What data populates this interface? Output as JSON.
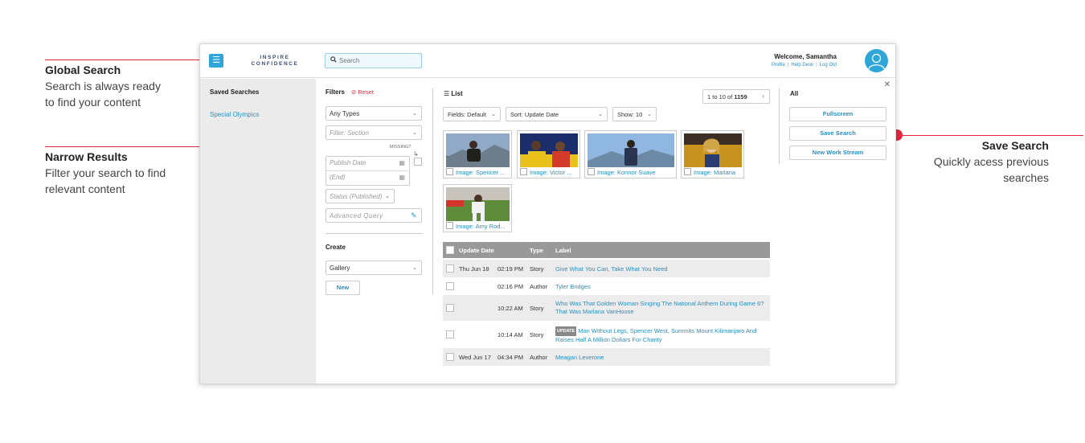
{
  "annotations": {
    "global_search": {
      "title": "Global Search",
      "line1": "Search is always ready",
      "line2": "to find your content"
    },
    "narrow_results": {
      "title": "Narrow Results",
      "line1": "Filter your search to find",
      "line2": "relevant content"
    },
    "save_search": {
      "title": "Save Search",
      "line1": "Quickly acess previous",
      "line2": "searches"
    }
  },
  "colors": {
    "accent": "#e8253d",
    "brand_blue": "#2fa6d8",
    "link": "#2a8fc1"
  },
  "header": {
    "brand_line1": "INSPIRE",
    "brand_line2": "CONFIDENCE",
    "search_placeholder": "Search",
    "welcome": "Welcome, Samantha",
    "links": [
      "Profile",
      "Help Desk",
      "Log Out"
    ]
  },
  "sidebar": {
    "title": "Saved Searches",
    "items": [
      "Special Olympics"
    ]
  },
  "filters": {
    "title": "Filters",
    "reset": "Reset",
    "types": "Any Types",
    "section_placeholder": "Filter: Section",
    "missing": "MISSING?",
    "publish_date": "Publish Date",
    "end": "(End)",
    "status": "Status (Published)",
    "advanced_query": "Advanced Query"
  },
  "create": {
    "title": "Create",
    "select": "Gallery",
    "new": "New"
  },
  "list": {
    "title": "List",
    "pager_prefix": "1 to 10 of",
    "pager_total": "1159",
    "fields": "Fields: Default",
    "sort": "Sort: Update Date",
    "show": "Show: 10",
    "thumbnails": [
      {
        "label": "Image: Spencer ..."
      },
      {
        "label": "Image: Victor ..."
      },
      {
        "label": "Image: Konnor Suave"
      },
      {
        "label": "Image: Marlana"
      },
      {
        "label": "Image: Amy Rod..."
      }
    ],
    "columns": [
      "Update Date",
      "Type",
      "Label"
    ],
    "rows": [
      {
        "date": "Thu Jun 18",
        "time": "02:19 PM",
        "type": "Story",
        "label": "Give What You Can, Take What You Need",
        "badge": ""
      },
      {
        "date": "",
        "time": "02:16 PM",
        "type": "Author",
        "label": "Tyler Bridges",
        "badge": ""
      },
      {
        "date": "",
        "time": "10:22 AM",
        "type": "Story",
        "label": "Who Was That Golden Woman Singing The National Anthem During Game 6? That Was Marlana VanHoose",
        "badge": ""
      },
      {
        "date": "",
        "time": "10:14 AM",
        "type": "Story",
        "label": "Man Without Legs, Spencer West, Summits Mount Kilimanjaro And Raises Half A Million Dollars For Charity",
        "badge": "UPDATE"
      },
      {
        "date": "Wed Jun 17",
        "time": "04:34 PM",
        "type": "Author",
        "label": "Meagan Leverone",
        "badge": ""
      }
    ]
  },
  "right_panel": {
    "title": "All",
    "buttons": [
      "Fullscreen",
      "Save Search",
      "New Work Stream"
    ]
  }
}
